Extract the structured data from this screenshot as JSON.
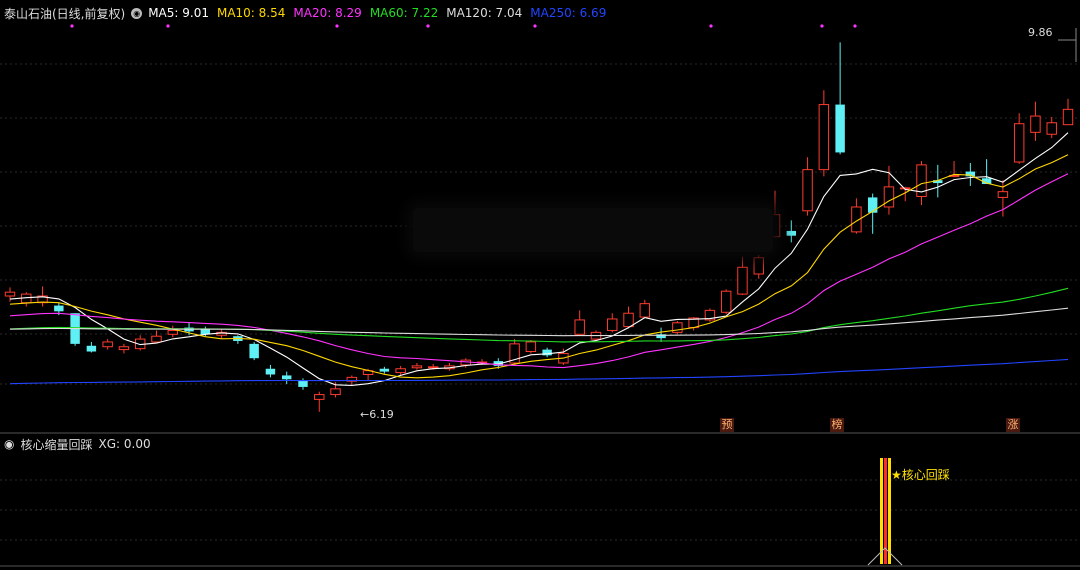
{
  "header": {
    "title": "泰山石油(日线,前复权)",
    "ma": [
      {
        "label": "MA5: 9.01",
        "color": "#ffffff"
      },
      {
        "label": "MA10: 8.54",
        "color": "#ffd700"
      },
      {
        "label": "MA20: 8.29",
        "color": "#ff33ff"
      },
      {
        "label": "MA60: 7.22",
        "color": "#22dd22"
      },
      {
        "label": "MA120: 7.04",
        "color": "#dddddd"
      },
      {
        "label": "MA250: 6.69",
        "color": "#2244ff"
      }
    ]
  },
  "price_labels": {
    "high": "9.86",
    "low": "6.19"
  },
  "tags": [
    "预",
    "榜",
    "涨"
  ],
  "indicator": {
    "title": "核心缩量回踩",
    "value_label": "XG: 0.00",
    "signal_text": "★核心回踩"
  },
  "chart_data": {
    "type": "candlestick",
    "ylim": [
      6.0,
      10.2
    ],
    "n": 66,
    "candles": [
      [
        7.4,
        7.44,
        7.49,
        7.34
      ],
      [
        7.33,
        7.42,
        7.44,
        7.29
      ],
      [
        7.33,
        7.4,
        7.5,
        7.29
      ],
      [
        7.3,
        7.24,
        7.33,
        7.2
      ],
      [
        7.22,
        6.9,
        7.22,
        6.88
      ],
      [
        6.88,
        6.82,
        6.92,
        6.81
      ],
      [
        6.87,
        6.92,
        6.95,
        6.84
      ],
      [
        6.84,
        6.87,
        6.9,
        6.8
      ],
      [
        6.85,
        6.95,
        6.99,
        6.83
      ],
      [
        6.92,
        6.98,
        7.04,
        6.92
      ],
      [
        7.0,
        7.04,
        7.09,
        6.97
      ],
      [
        7.07,
        7.03,
        7.12,
        6.99
      ],
      [
        7.06,
        7.0,
        7.08,
        6.98
      ],
      [
        6.99,
        7.02,
        7.05,
        6.96
      ],
      [
        6.98,
        6.93,
        6.99,
        6.9
      ],
      [
        6.9,
        6.75,
        6.92,
        6.73
      ],
      [
        6.64,
        6.58,
        6.68,
        6.55
      ],
      [
        6.57,
        6.53,
        6.61,
        6.48
      ],
      [
        6.52,
        6.45,
        6.54,
        6.42
      ],
      [
        6.32,
        6.37,
        6.4,
        6.19
      ],
      [
        6.37,
        6.43,
        6.5,
        6.34
      ],
      [
        6.51,
        6.55,
        6.57,
        6.47
      ],
      [
        6.58,
        6.62,
        6.64,
        6.52
      ],
      [
        6.64,
        6.61,
        6.66,
        6.59
      ],
      [
        6.6,
        6.64,
        6.67,
        6.57
      ],
      [
        6.65,
        6.67,
        6.7,
        6.63
      ],
      [
        6.65,
        6.66,
        6.69,
        6.63
      ],
      [
        6.64,
        6.67,
        6.7,
        6.62
      ],
      [
        6.68,
        6.73,
        6.75,
        6.65
      ],
      [
        6.7,
        6.71,
        6.74,
        6.68
      ],
      [
        6.72,
        6.67,
        6.75,
        6.64
      ],
      [
        6.7,
        6.9,
        6.95,
        6.68
      ],
      [
        6.82,
        6.92,
        6.94,
        6.8
      ],
      [
        6.84,
        6.78,
        6.86,
        6.76
      ],
      [
        6.7,
        6.8,
        6.85,
        6.68
      ],
      [
        7.0,
        7.15,
        7.25,
        7.0
      ],
      [
        6.95,
        7.02,
        7.04,
        6.93
      ],
      [
        7.04,
        7.16,
        7.22,
        7.02
      ],
      [
        7.08,
        7.22,
        7.29,
        7.06
      ],
      [
        7.18,
        7.32,
        7.36,
        7.17
      ],
      [
        7.0,
        6.96,
        7.07,
        6.92
      ],
      [
        7.02,
        7.12,
        7.14,
        7.0
      ],
      [
        7.07,
        7.17,
        7.18,
        7.04
      ],
      [
        7.15,
        7.25,
        7.27,
        7.13
      ],
      [
        7.23,
        7.45,
        7.47,
        7.21
      ],
      [
        7.42,
        7.7,
        7.81,
        7.41
      ],
      [
        7.63,
        7.8,
        7.83,
        7.58
      ],
      [
        8.02,
        8.25,
        8.5,
        8.01
      ],
      [
        8.08,
        8.03,
        8.19,
        7.96
      ],
      [
        8.29,
        8.72,
        8.85,
        8.24
      ],
      [
        8.72,
        9.4,
        9.55,
        8.65
      ],
      [
        9.4,
        8.9,
        10.05,
        8.88
      ],
      [
        8.07,
        8.33,
        8.42,
        8.05
      ],
      [
        8.43,
        8.27,
        8.47,
        8.05
      ],
      [
        8.33,
        8.54,
        8.76,
        8.25
      ],
      [
        8.52,
        8.53,
        8.54,
        8.39
      ],
      [
        8.44,
        8.77,
        8.81,
        8.35
      ],
      [
        8.61,
        8.58,
        8.77,
        8.43
      ],
      [
        8.66,
        8.66,
        8.81,
        8.64
      ],
      [
        8.7,
        8.65,
        8.79,
        8.55
      ],
      [
        8.63,
        8.57,
        8.83,
        8.58
      ],
      [
        8.43,
        8.49,
        8.61,
        8.23
      ],
      [
        8.8,
        9.2,
        9.31,
        8.78
      ],
      [
        9.11,
        9.28,
        9.43,
        9.02
      ],
      [
        9.09,
        9.21,
        9.27,
        9.05
      ],
      [
        9.19,
        9.35,
        9.46,
        9.19
      ]
    ]
  }
}
